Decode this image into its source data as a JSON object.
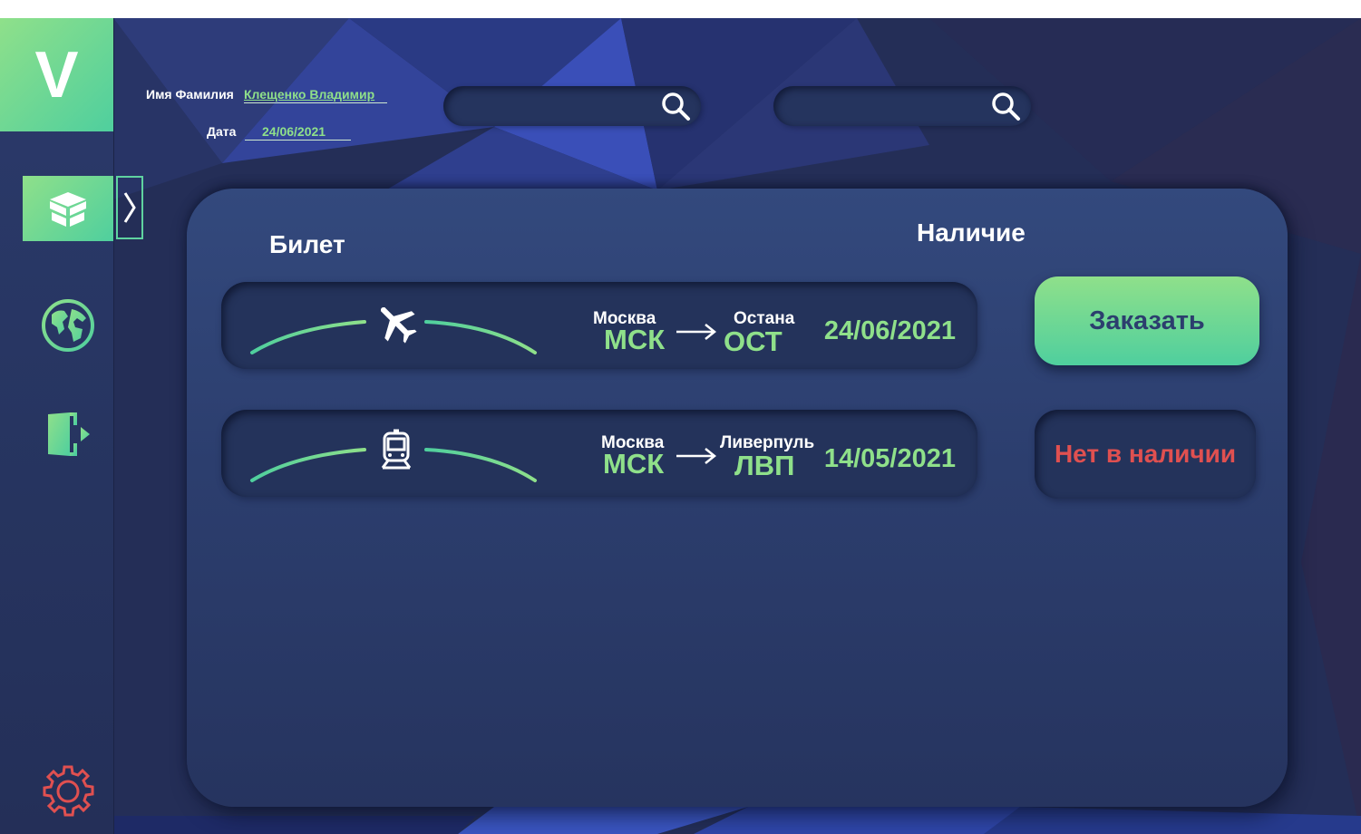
{
  "logo": {
    "letter": "V"
  },
  "header": {
    "name_label": "Имя Фамилия",
    "name_value": "Клещенко Владимир",
    "date_label": "Дата",
    "date_value": "24/06/2021"
  },
  "search": [
    {
      "placeholder": "",
      "icon": "search-icon"
    },
    {
      "placeholder": "",
      "icon": "search-icon"
    }
  ],
  "sidebar": {
    "items": [
      {
        "name": "tickets",
        "icon": "open-box-icon",
        "active": true
      },
      {
        "name": "world",
        "icon": "globe-icon",
        "active": false
      },
      {
        "name": "logout",
        "icon": "exit-door-icon",
        "active": false
      },
      {
        "name": "settings",
        "icon": "gear-icon",
        "active": false
      }
    ],
    "toggle_icon": "chevron-right-icon"
  },
  "panel": {
    "ticket_header": "Билет",
    "availability_header": "Наличие",
    "tickets": [
      {
        "transport_icon": "airplane-icon",
        "from_name": "Москва",
        "from_code": "МСК",
        "to_name": "Остана",
        "to_code": "ОСТ",
        "date": "24/06/2021",
        "availability": "Заказать",
        "available": true
      },
      {
        "transport_icon": "train-icon",
        "from_name": "Москва",
        "from_code": "МСК",
        "to_name": "Ливерпуль",
        "to_code": "ЛВП",
        "date": "14/05/2021",
        "availability": "Нет в наличии",
        "available": false
      }
    ]
  },
  "colors": {
    "accent_green": "#8fe08a",
    "accent_teal": "#4fcf9e",
    "panel": "#2c3e6e",
    "unavailable_red": "#e05050",
    "gear_red": "#e05050"
  }
}
